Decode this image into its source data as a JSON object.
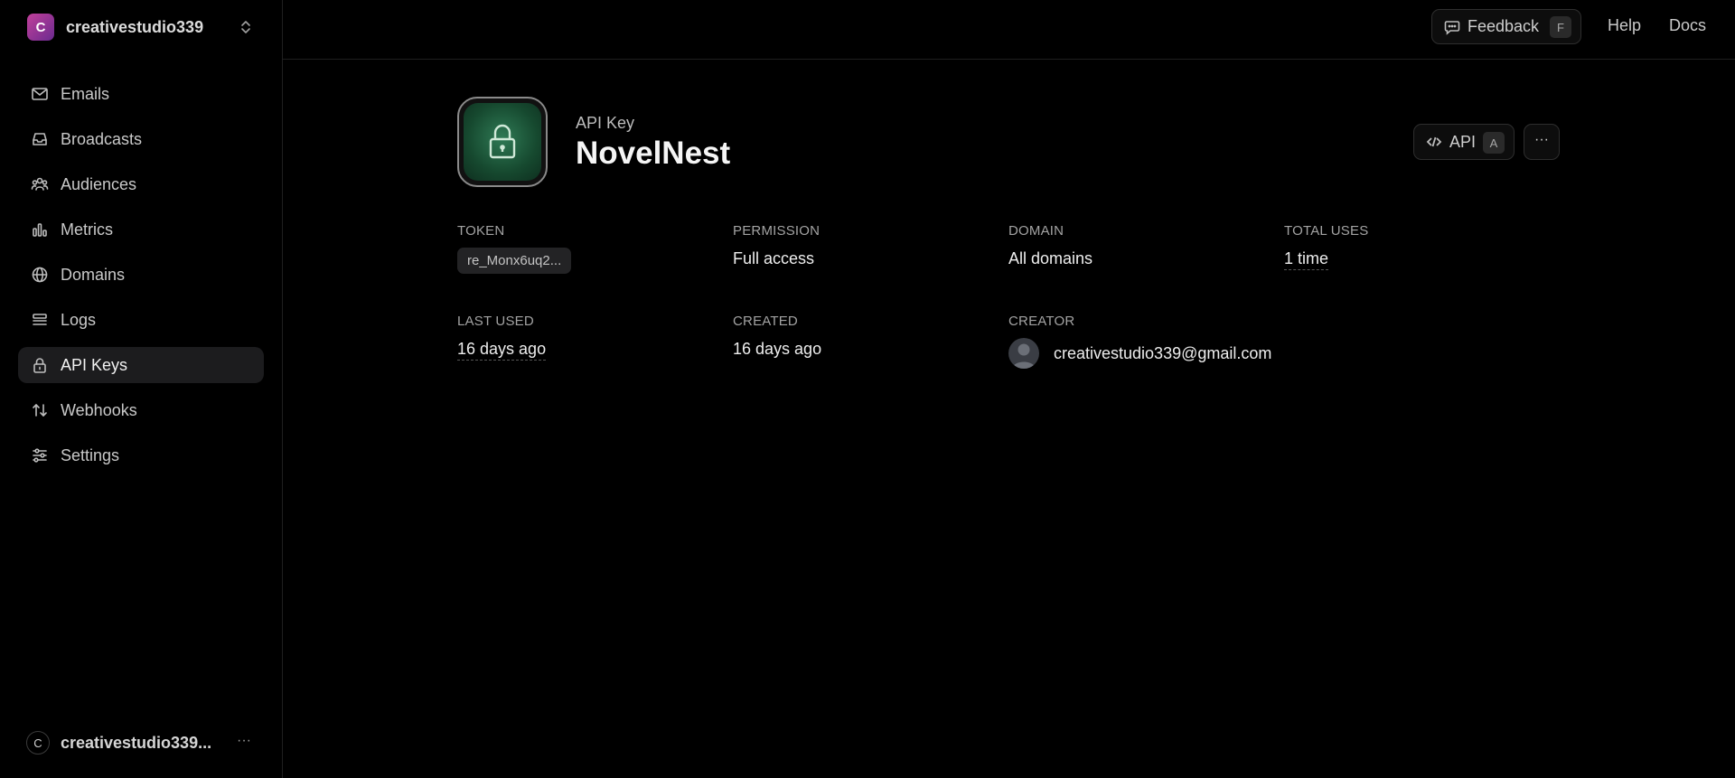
{
  "workspace": {
    "initial": "C",
    "name": "creativestudio339"
  },
  "sidebar": {
    "items": [
      {
        "label": "Emails",
        "icon": "mail-icon"
      },
      {
        "label": "Broadcasts",
        "icon": "inbox-icon"
      },
      {
        "label": "Audiences",
        "icon": "users-icon"
      },
      {
        "label": "Metrics",
        "icon": "bar-chart-icon"
      },
      {
        "label": "Domains",
        "icon": "globe-icon"
      },
      {
        "label": "Logs",
        "icon": "logs-icon"
      },
      {
        "label": "API Keys",
        "icon": "lock-icon",
        "active": true
      },
      {
        "label": "Webhooks",
        "icon": "webhook-icon"
      },
      {
        "label": "Settings",
        "icon": "sliders-icon"
      }
    ],
    "user": {
      "initial": "C",
      "name": "creativestudio339...",
      "menu": "···"
    }
  },
  "topbar": {
    "feedback_label": "Feedback",
    "feedback_shortcut": "F",
    "help_label": "Help",
    "docs_label": "Docs"
  },
  "header": {
    "kicker": "API Key",
    "title": "NovelNest",
    "api_label": "API",
    "api_shortcut": "A",
    "more_label": "···"
  },
  "details": {
    "token": {
      "label": "TOKEN",
      "value": "re_Monx6uq2..."
    },
    "permission": {
      "label": "PERMISSION",
      "value": "Full access"
    },
    "domain": {
      "label": "DOMAIN",
      "value": "All domains"
    },
    "total_uses": {
      "label": "TOTAL USES",
      "value": "1 time"
    },
    "last_used": {
      "label": "LAST USED",
      "value": "16 days ago"
    },
    "created": {
      "label": "CREATED",
      "value": "16 days ago"
    },
    "creator": {
      "label": "CREATOR",
      "value": "creativestudio339@gmail.com"
    }
  },
  "colors": {
    "background": "#000000",
    "active_nav": "#1c1c1e",
    "accent_green": "#2f7a55",
    "workspace_avatar": "#c1409a"
  }
}
